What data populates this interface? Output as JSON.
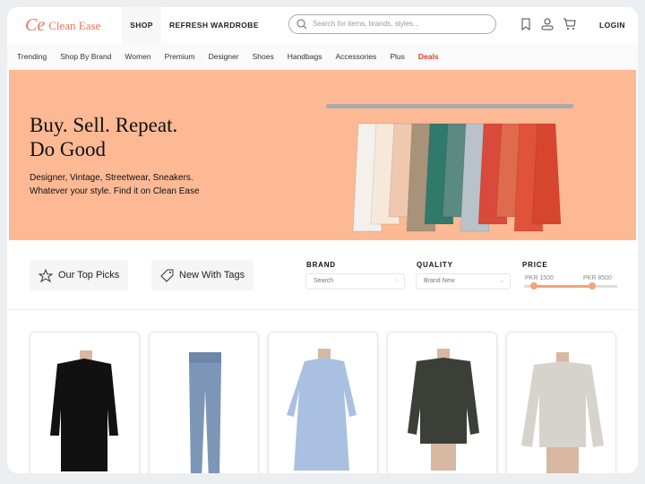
{
  "header": {
    "brand": "Clean Ease",
    "tabs": [
      "SHOP",
      "REFRESH WARDROBE"
    ],
    "search_placeholder": "Search for items, brands, styles...",
    "login": "LOGIN"
  },
  "nav": [
    "Trending",
    "Shop By Brand",
    "Women",
    "Premium",
    "Designer",
    "Shoes",
    "Handbags",
    "Accessories",
    "Plus",
    "Deals"
  ],
  "colors": {
    "accent": "#f0715a",
    "hero_bg": "#fdb994",
    "deals": "#e8392b",
    "slider": "#f5a27a"
  },
  "hero": {
    "title_line1": "Buy. Sell. Repeat.",
    "title_line2": "Do Good",
    "sub_line1": "Designer, Vintage, Streetwear, Sneakers.",
    "sub_line2": "Whatever your style. Find it on Clean Ease"
  },
  "filters": {
    "top_picks": "Our Top Picks",
    "new_tags": "New With Tags",
    "brand": {
      "label": "BRAND",
      "placeholder": "Search"
    },
    "quality": {
      "label": "QUALITY",
      "value": "Brand New"
    },
    "price": {
      "label": "PRICE",
      "min": "PKR 1500",
      "max": "PKR 8500"
    }
  },
  "products": [
    {
      "item": "black blazer"
    },
    {
      "item": "jeans"
    },
    {
      "item": "blue dress"
    },
    {
      "item": "leather jacket"
    },
    {
      "item": "grey sweater"
    }
  ]
}
